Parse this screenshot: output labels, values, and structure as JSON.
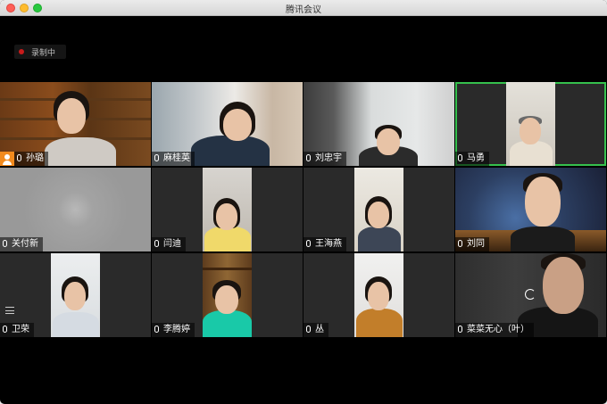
{
  "window": {
    "title": "腾讯会议"
  },
  "recording": {
    "label": "录制中"
  },
  "participants": [
    {
      "name": "孙璐"
    },
    {
      "name": "麻桂英"
    },
    {
      "name": "刘忠宇"
    },
    {
      "name": "马勇"
    },
    {
      "name": "关付新"
    },
    {
      "name": "闫迪"
    },
    {
      "name": "王海燕"
    },
    {
      "name": "刘同"
    },
    {
      "name": "卫荣"
    },
    {
      "name": "李腾婷"
    },
    {
      "name": "丛"
    },
    {
      "name": "菜菜无心（叶）"
    }
  ],
  "colors": {
    "active_speaker_border": "#35c04d",
    "recording_dot": "#c81b1b",
    "host_badge": "#f28a1d"
  }
}
